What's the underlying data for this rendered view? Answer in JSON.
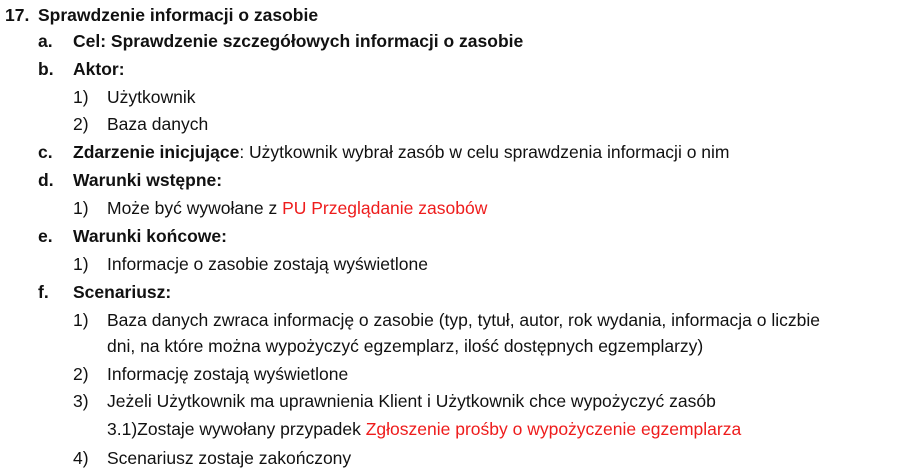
{
  "heading": {
    "number": "17.",
    "title": "Sprawdzenie informacji o zasobie"
  },
  "colors": {
    "text": "#111111",
    "link": "#ee1c1c"
  },
  "items": {
    "a": {
      "marker": "a.",
      "text": "Cel: Sprawdzenie szczegółowych informacji o zasobie"
    },
    "b": {
      "marker": "b.",
      "label": "Aktor:",
      "subitems": [
        {
          "marker": "1)",
          "text": "Użytkownik"
        },
        {
          "marker": "2)",
          "text": "Baza danych"
        }
      ]
    },
    "c": {
      "marker": "c.",
      "label": "Zdarzenie inicjujące",
      "text": ": Użytkownik wybrał zasób w celu sprawdzenia informacji o nim"
    },
    "d": {
      "marker": "d.",
      "label": "Warunki wstępne:",
      "subitems": [
        {
          "marker": "1)",
          "text": "Może być wywołane z ",
          "link": "PU Przeglądanie zasobów"
        }
      ]
    },
    "e": {
      "marker": "e.",
      "label": "Warunki końcowe:",
      "subitems": [
        {
          "marker": "1)",
          "text": "Informacje o zasobie zostają wyświetlone"
        }
      ]
    },
    "f": {
      "marker": "f.",
      "label": "Scenariusz:",
      "subitems": [
        {
          "marker": "1)",
          "text_line1": "Baza danych zwraca informację o zasobie (typ, tytuł, autor, rok wydania, informacja o liczbie",
          "text_line2": "dni, na które można wypożyczyć egzemplarz, ilość dostępnych egzemplarzy)"
        },
        {
          "marker": "2)",
          "text": "Informację zostają wyświetlone"
        },
        {
          "marker": "3)",
          "text": "Jeżeli Użytkownik ma uprawnienia Klient i Użytkownik chce wypożyczyć zasób",
          "nested": {
            "marker": "3.1)",
            "text": "Zostaje wywołany przypadek ",
            "link": "Zgłoszenie prośby o wypożyczenie egzemplarza"
          }
        },
        {
          "marker": "4)",
          "text": "Scenariusz zostaje zakończony"
        }
      ]
    }
  }
}
